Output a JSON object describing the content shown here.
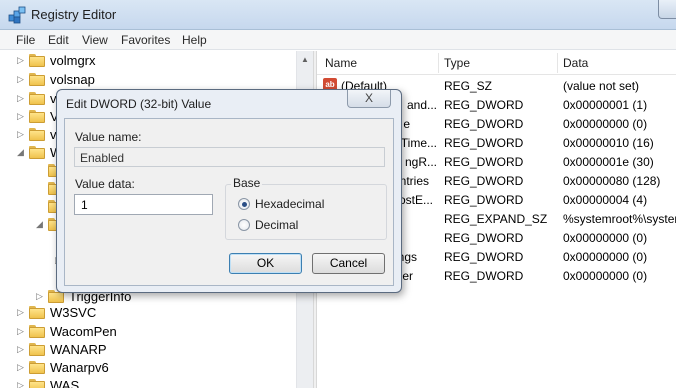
{
  "window": {
    "title": "Registry Editor"
  },
  "menu": [
    "File",
    "Edit",
    "View",
    "Favorites",
    "Help"
  ],
  "tree": [
    {
      "label": "volmgrx",
      "expanded": false
    },
    {
      "label": "volsnap",
      "expanded": false
    },
    {
      "label": "v",
      "expanded": false
    },
    {
      "label": "V",
      "expanded": false
    },
    {
      "label": "v",
      "expanded": false
    },
    {
      "label": "W",
      "expanded": true
    },
    {
      "label": "",
      "expanded": false
    },
    {
      "label": "",
      "expanded": false
    },
    {
      "label": "",
      "expanded": false
    },
    {
      "label": "",
      "expanded": true
    },
    {
      "label": "",
      "expanded": false
    },
    {
      "label": "",
      "expanded": false
    },
    {
      "label": "TriggerInfo",
      "expanded": false
    },
    {
      "label": "W3SVC",
      "expanded": false
    },
    {
      "label": "WacomPen",
      "expanded": false
    },
    {
      "label": "WANARP",
      "expanded": false
    },
    {
      "label": "Wanarpv6",
      "expanded": false
    },
    {
      "label": "WAS",
      "expanded": false
    }
  ],
  "list": {
    "columns": [
      "Name",
      "Type",
      "Data"
    ],
    "rows": [
      {
        "name": "(Default)",
        "type": "REG_SZ",
        "data": "(value not set)",
        "icon": "string-value-icon"
      },
      {
        "name": "and...",
        "type": "REG_DWORD",
        "data": "0x00000001 (1)"
      },
      {
        "name": "e",
        "type": "REG_DWORD",
        "data": "0x00000000 (0)"
      },
      {
        "name": "Time...",
        "type": "REG_DWORD",
        "data": "0x00000010 (16)"
      },
      {
        "name": "ngR...",
        "type": "REG_DWORD",
        "data": "0x0000001e (30)"
      },
      {
        "name": "ntries",
        "type": "REG_DWORD",
        "data": "0x00000080 (128)"
      },
      {
        "name": "ostE...",
        "type": "REG_DWORD",
        "data": "0x00000004 (4)"
      },
      {
        "name": "",
        "type": "REG_EXPAND_SZ",
        "data": "%systemroot%\\system"
      },
      {
        "name": "",
        "type": "REG_DWORD",
        "data": "0x00000000 (0)"
      },
      {
        "name": "ngs",
        "type": "REG_DWORD",
        "data": "0x00000000 (0)"
      },
      {
        "name": "er",
        "type": "REG_DWORD",
        "data": "0x00000000 (0)"
      }
    ]
  },
  "dialog": {
    "title": "Edit DWORD (32-bit) Value",
    "close_label": "X",
    "value_name_label": "Value name:",
    "value_name": "Enabled",
    "value_data_label": "Value data:",
    "value_data": "1",
    "base_label": "Base",
    "base_options": [
      "Hexadecimal",
      "Decimal"
    ],
    "base_selected": "Hexadecimal",
    "ok_label": "OK",
    "cancel_label": "Cancel"
  }
}
